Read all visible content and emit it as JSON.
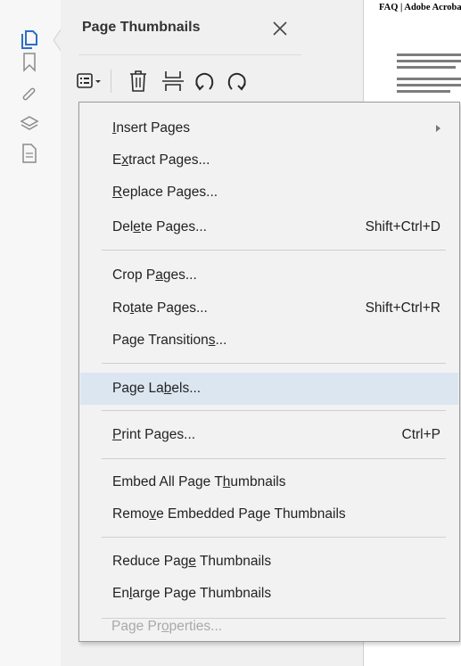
{
  "side_rail": {
    "items": [
      {
        "icon": "page-thumbnails-icon",
        "active": true
      },
      {
        "icon": "bookmark-icon"
      },
      {
        "icon": "attachment-icon"
      },
      {
        "icon": "layers-icon"
      },
      {
        "icon": "document-icon"
      }
    ],
    "accent_color": "#2d6dc8"
  },
  "panel": {
    "title": "Page Thumbnails",
    "toolbar": [
      "options-menu-icon",
      "delete-icon",
      "insert-icon",
      "rotate-left-icon",
      "rotate-right-icon"
    ]
  },
  "document": {
    "title": "FAQ | Adobe Acroba"
  },
  "menu": {
    "items": [
      {
        "pre": "",
        "u": "I",
        "post": "nsert Pages",
        "shortcut": "",
        "submenu": true
      },
      {
        "pre": "E",
        "u": "x",
        "post": "tract Pages...",
        "shortcut": ""
      },
      {
        "pre": "",
        "u": "R",
        "post": "eplace Pages...",
        "shortcut": ""
      },
      {
        "pre": "Del",
        "u": "e",
        "post": "te Pages...",
        "shortcut": "Shift+Ctrl+D"
      },
      {
        "pre": "Crop P",
        "u": "a",
        "post": "ges...",
        "shortcut": ""
      },
      {
        "pre": "Ro",
        "u": "t",
        "post": "ate Pages...",
        "shortcut": "Shift+Ctrl+R"
      },
      {
        "pre": "Page Transition",
        "u": "s",
        "post": "...",
        "shortcut": ""
      },
      {
        "pre": "Page La",
        "u": "b",
        "post": "els...",
        "shortcut": "",
        "highlighted": true
      },
      {
        "pre": "",
        "u": "P",
        "post": "rint Pages...",
        "shortcut": "Ctrl+P"
      },
      {
        "pre": "Embed All Page T",
        "u": "h",
        "post": "umbnails",
        "shortcut": ""
      },
      {
        "pre": "Remo",
        "u": "v",
        "post": "e Embedded Page Thumbnails",
        "shortcut": ""
      },
      {
        "pre": "Reduce Pag",
        "u": "e",
        "post": " Thumbnails",
        "shortcut": ""
      },
      {
        "pre": "En",
        "u": "l",
        "post": "arge Page Thumbnails",
        "shortcut": ""
      },
      {
        "pre": "Page Pr",
        "u": "o",
        "post": "perties...",
        "shortcut": "",
        "disabled": true
      }
    ],
    "highlight_color": "#dce6f1"
  }
}
